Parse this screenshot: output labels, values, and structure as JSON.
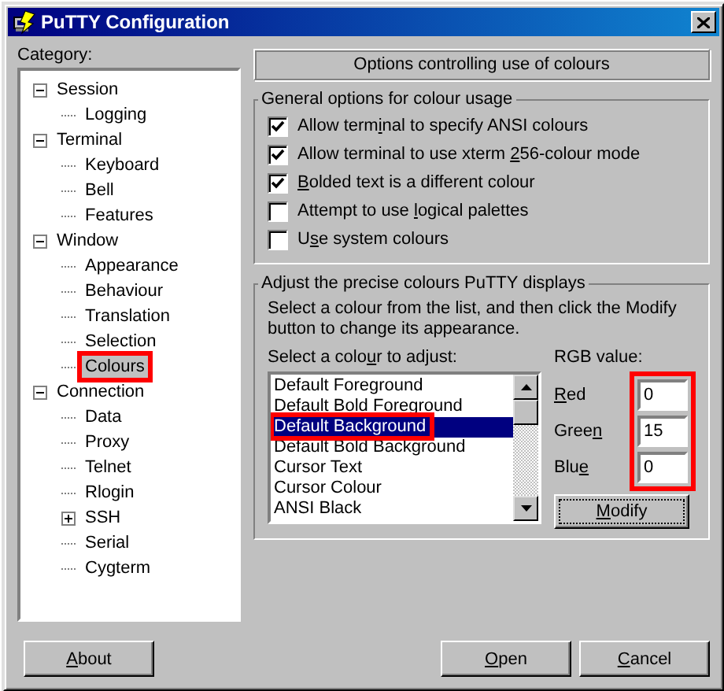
{
  "window": {
    "title": "PuTTY Configuration"
  },
  "category": {
    "before": "Cate",
    "key": "g",
    "after": "ory:"
  },
  "tree": [
    {
      "label": "Session",
      "expanded": true,
      "selected": false,
      "highlighted": false,
      "children": [
        {
          "label": "Logging",
          "selected": false,
          "highlighted": false
        }
      ]
    },
    {
      "label": "Terminal",
      "expanded": true,
      "selected": false,
      "highlighted": false,
      "children": [
        {
          "label": "Keyboard",
          "selected": false,
          "highlighted": false
        },
        {
          "label": "Bell",
          "selected": false,
          "highlighted": false
        },
        {
          "label": "Features",
          "selected": false,
          "highlighted": false
        }
      ]
    },
    {
      "label": "Window",
      "expanded": true,
      "selected": false,
      "highlighted": false,
      "children": [
        {
          "label": "Appearance",
          "selected": false,
          "highlighted": false
        },
        {
          "label": "Behaviour",
          "selected": false,
          "highlighted": false
        },
        {
          "label": "Translation",
          "selected": false,
          "highlighted": false
        },
        {
          "label": "Selection",
          "selected": false,
          "highlighted": false
        },
        {
          "label": "Colours",
          "selected": true,
          "highlighted": true
        }
      ]
    },
    {
      "label": "Connection",
      "expanded": true,
      "selected": false,
      "highlighted": false,
      "children": [
        {
          "label": "Data",
          "selected": false,
          "highlighted": false
        },
        {
          "label": "Proxy",
          "selected": false,
          "highlighted": false
        },
        {
          "label": "Telnet",
          "selected": false,
          "highlighted": false
        },
        {
          "label": "Rlogin",
          "selected": false,
          "highlighted": false
        },
        {
          "label": "SSH",
          "expanded": false,
          "selected": false,
          "highlighted": false
        },
        {
          "label": "Serial",
          "selected": false,
          "highlighted": false
        },
        {
          "label": "Cygterm",
          "selected": false,
          "highlighted": false
        }
      ]
    }
  ],
  "panel_title": "Options controlling use of colours",
  "general_group": {
    "title": "General options for colour usage",
    "options": [
      {
        "before": "Allow term",
        "key": "i",
        "after": "nal to specify ANSI colours",
        "checked": true
      },
      {
        "before": "Allow terminal to use xterm ",
        "key": "2",
        "after": "56-colour mode",
        "checked": true
      },
      {
        "key": "B",
        "after": "olded text is a different colour",
        "checked": true
      },
      {
        "before": "Attempt to use ",
        "key": "l",
        "after": "ogical palettes",
        "checked": false
      },
      {
        "before": "U",
        "key": "s",
        "after": "e system colours",
        "checked": false
      }
    ]
  },
  "adjust_group": {
    "title": "Adjust the precise colours PuTTY displays",
    "description": "Select a colour from the list, and then click the Modify button to change its appearance.",
    "list_label": {
      "before": "Select a colo",
      "key": "u",
      "after": "r to adjust:"
    },
    "colours": [
      {
        "label": "Default Foreground",
        "selected": false,
        "highlighted": false
      },
      {
        "label": "Default Bold Foreground",
        "selected": false,
        "highlighted": false
      },
      {
        "label": "Default Background",
        "selected": true,
        "highlighted": true
      },
      {
        "label": "Default Bold Background",
        "selected": false,
        "highlighted": false
      },
      {
        "label": "Cursor Text",
        "selected": false,
        "highlighted": false
      },
      {
        "label": "Cursor Colour",
        "selected": false,
        "highlighted": false
      },
      {
        "label": "ANSI Black",
        "selected": false,
        "highlighted": false
      }
    ],
    "rgb_label": "RGB value:",
    "rgb_highlighted": true,
    "rgb": [
      {
        "key": "R",
        "after": "ed",
        "value": "0"
      },
      {
        "before": "Gree",
        "key": "n",
        "value": "15"
      },
      {
        "before": "Blu",
        "key": "e",
        "value": "0"
      }
    ],
    "modify_button": {
      "key": "M",
      "after": "odify"
    }
  },
  "buttons": [
    {
      "key": "A",
      "after": "bout"
    },
    {
      "key": "O",
      "after": "pen"
    },
    {
      "key": "C",
      "after": "ancel"
    }
  ]
}
